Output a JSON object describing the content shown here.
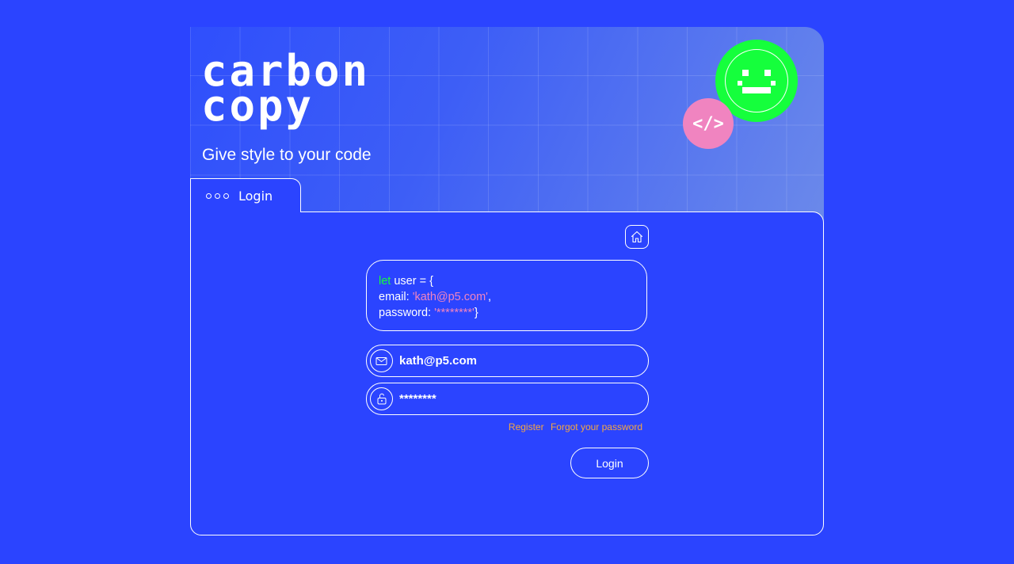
{
  "brand": {
    "line1": "carbon",
    "line2": "copy",
    "tagline": "Give style to your code"
  },
  "badges": {
    "code_glyph": "</>",
    "smiley_icon": "pixel-smiley-icon"
  },
  "tab": {
    "label": "Login"
  },
  "code_preview": {
    "keyword": "let",
    "line1_rest": " user = {",
    "email_key": "email: ",
    "email_value": "'kath@p5.com'",
    "email_suffix": ",",
    "password_key": "password: ",
    "password_value": "'********'",
    "closing": "}"
  },
  "form": {
    "email_value": "kath@p5.com",
    "password_value": "********"
  },
  "links": {
    "register": "Register",
    "forgot": "Forgot your password"
  },
  "buttons": {
    "login": "Login"
  },
  "colors": {
    "background": "#2b44ff",
    "keyword": "#15ff3c",
    "string": "#f084c0",
    "link": "#f6a640",
    "smiley": "#15ff3c",
    "code_badge": "#f084c0"
  }
}
